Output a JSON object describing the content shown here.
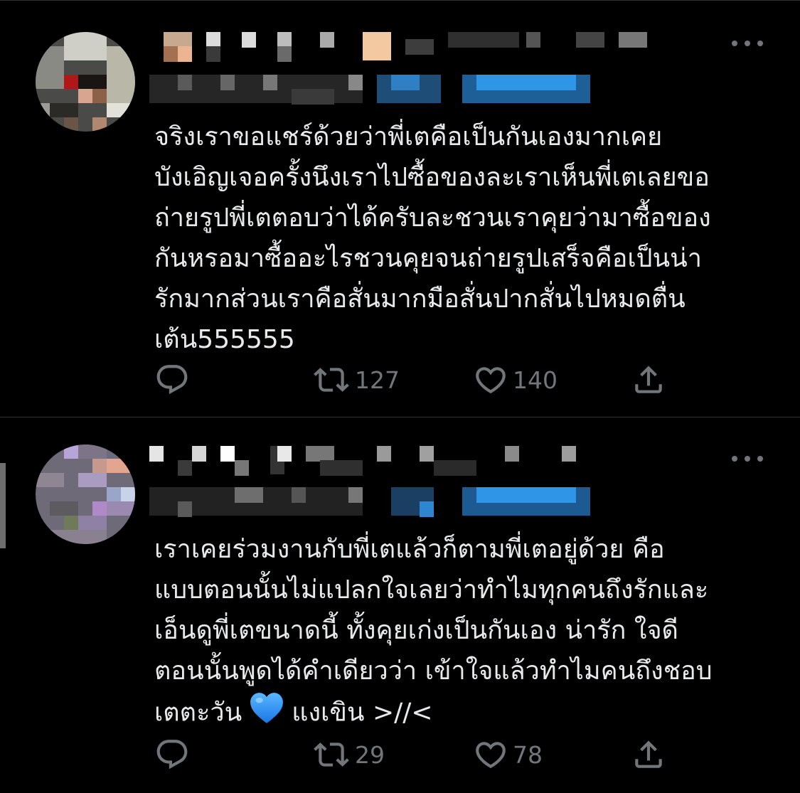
{
  "tweets": [
    {
      "text": "จริงเราขอแชร์ด้วยว่าพี่เตคือเป็นกันเองมากเคย\nบังเอิญเจอครั้งนึงเราไปซื้อของละเราเห็นพี่เตเลยขอ\nถ่ายรูปพี่เตตอบว่าได้ครับละชวนเราคุยว่ามาซื้อของ\nกันหรอมาซื้ออะไรชวนคุยจนถ่ายรูปเสร็จคือเป็นน่า\nรักมากส่วนเราคือสั่นมากมือสั่นปากสั่นไปหมดตื่น\nเต้น555555",
      "retweet_count": "127",
      "like_count": "140",
      "reply_count": ""
    },
    {
      "text_before_emoji": "เราเคยร่วมงานกับพี่เตแล้วก็ตามพี่เตอยู่ด้วย คือ\nแบบตอนนั้นไม่แปลกใจเลยว่าทำไมทุกคนถึงรักและ\nเอ็นดูพี่เตขนาดนี้ ทั้งคุยเก่งเป็นกันเอง น่ารัก ใจดี\nตอนนั้นพูดได้คำเดียวว่า เข้าใจแล้วทำไมคนถึงชอบ\nเตตะวัน",
      "emoji": "blue-heart",
      "text_after_emoji": "แงเขิน >//<",
      "retweet_count": "29",
      "like_count": "78",
      "reply_count": ""
    }
  ],
  "icons": {
    "reply": "reply-icon",
    "retweet": "retweet-icon",
    "like": "heart-icon",
    "share": "share-icon",
    "more": "more-icon"
  },
  "colors": {
    "background": "#000000",
    "text": "#e7e9ea",
    "secondary": "#71767b",
    "divider": "#2f3336",
    "emoji_blue": "#1d9bf0"
  }
}
